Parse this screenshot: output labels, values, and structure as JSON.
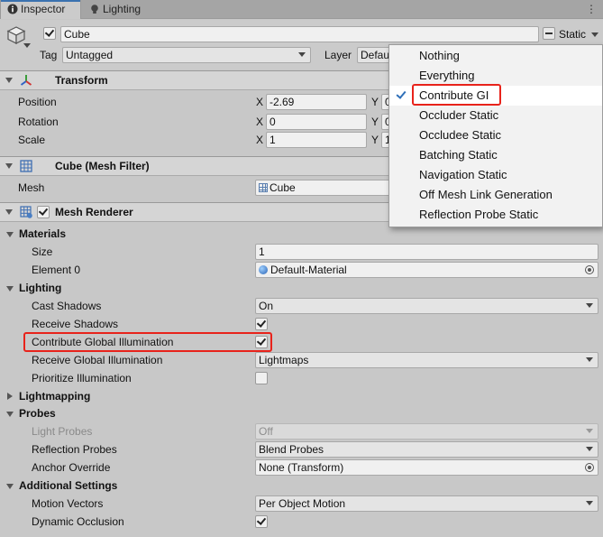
{
  "tabs": {
    "inspector": "Inspector",
    "lighting": "Lighting",
    "menu": "⋮"
  },
  "gameobject": {
    "name": "Cube",
    "static_label": "Static",
    "tag_label": "Tag",
    "tag_value": "Untagged",
    "layer_label": "Layer",
    "layer_value": "Defau"
  },
  "transform": {
    "title": "Transform",
    "position_label": "Position",
    "rotation_label": "Rotation",
    "scale_label": "Scale",
    "x": "X",
    "y": "Y",
    "position_x": "-2.69",
    "position_y": "0",
    "rotation_x": "0",
    "rotation_y": "0",
    "scale_x": "1",
    "scale_y": "1"
  },
  "mesh_filter": {
    "title": "Cube (Mesh Filter)",
    "mesh_label": "Mesh",
    "mesh_value": "Cube"
  },
  "mesh_renderer": {
    "title": "Mesh Renderer",
    "materials": {
      "header": "Materials",
      "size_label": "Size",
      "size_value": "1",
      "element0_label": "Element 0",
      "element0_value": "Default-Material"
    },
    "lighting": {
      "header": "Lighting",
      "cast_shadows_label": "Cast Shadows",
      "cast_shadows_value": "On",
      "receive_shadows_label": "Receive Shadows",
      "receive_shadows_checked": true,
      "contribute_gi_label": "Contribute Global Illumination",
      "contribute_gi_checked": true,
      "receive_gi_label": "Receive Global Illumination",
      "receive_gi_value": "Lightmaps",
      "prioritize_label": "Prioritize Illumination",
      "prioritize_checked": false
    },
    "lightmapping": {
      "header": "Lightmapping"
    },
    "probes": {
      "header": "Probes",
      "light_probes_label": "Light Probes",
      "light_probes_value": "Off",
      "reflection_probes_label": "Reflection Probes",
      "reflection_probes_value": "Blend Probes",
      "anchor_override_label": "Anchor Override",
      "anchor_override_value": "None (Transform)"
    },
    "additional": {
      "header": "Additional Settings",
      "motion_vectors_label": "Motion Vectors",
      "motion_vectors_value": "Per Object Motion",
      "dynamic_occlusion_label": "Dynamic Occlusion",
      "dynamic_occlusion_checked": true
    }
  },
  "static_menu": {
    "items": [
      "Nothing",
      "Everything",
      "Contribute GI",
      "Occluder Static",
      "Occludee Static",
      "Batching Static",
      "Navigation Static",
      "Off Mesh Link Generation",
      "Reflection Probe Static"
    ],
    "selected_index": 2
  },
  "colors": {
    "highlight_box": "#e8231b",
    "check_accent": "#2e6fb8"
  }
}
